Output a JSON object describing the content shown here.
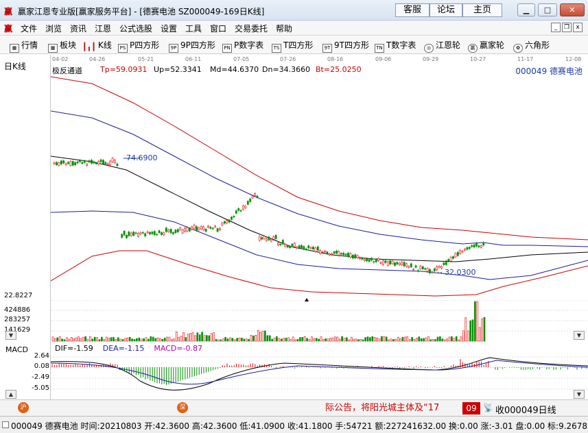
{
  "window": {
    "app_icon": "赢",
    "title": "赢家江恩专业版[赢家服务平台] - [德赛电池  SZ000049-169日K线]",
    "links": [
      "客服",
      "论坛",
      "主页"
    ],
    "buttons": [
      "minimize-icon",
      "maximize-icon",
      "close-icon"
    ]
  },
  "menu": {
    "icon": "赢",
    "items": [
      "文件",
      "浏览",
      "资讯",
      "江恩",
      "公式选股",
      "设置",
      "工具",
      "窗口",
      "交易委托",
      "帮助"
    ]
  },
  "toolbar": {
    "items": [
      {
        "label": "行情",
        "icon": "grid-icon",
        "glyph": "▦"
      },
      {
        "label": "板块",
        "icon": "blocks-icon",
        "glyph": "▦"
      },
      {
        "label": "K线",
        "icon": "candlestick-icon",
        "glyph": "┃╻┃"
      },
      {
        "label": "P四方形",
        "icon": "p-square-icon",
        "glyph": "PS"
      },
      {
        "label": "9P四方形",
        "icon": "9p-square-icon",
        "glyph": "9P"
      },
      {
        "label": "P数字表",
        "icon": "p-number-table-icon",
        "glyph": "PN"
      },
      {
        "label": "T四方形",
        "icon": "t-square-icon",
        "glyph": "TS"
      },
      {
        "label": "9T四方形",
        "icon": "9t-square-icon",
        "glyph": "9T"
      },
      {
        "label": "T数字表",
        "icon": "t-number-table-icon",
        "glyph": "TN"
      },
      {
        "label": "江恩轮",
        "icon": "gann-wheel-icon",
        "glyph": "◎"
      },
      {
        "label": "赢家轮",
        "icon": "winner-wheel-icon",
        "glyph": "赢"
      },
      {
        "label": "六角形",
        "icon": "hexagon-icon",
        "glyph": "✿"
      }
    ]
  },
  "chart": {
    "period": "日K线",
    "dates": [
      "04-02",
      "04-26",
      "05-21",
      "06-11",
      "07-05",
      "07-26",
      "08-16",
      "09-06",
      "09-29",
      "10-27",
      "11-17",
      "12-08"
    ],
    "indicator": {
      "name": "极反通道",
      "tp": "Tp=59.0931",
      "up": "Up=52.3341",
      "md": "Md=44.6370",
      "dn": "Dn=34.3660",
      "bt": "Bt=25.0250"
    },
    "stock_label": "000049  德赛电池",
    "annot_high": "74.6900",
    "annot_low": "32.0300",
    "volume_axis": [
      "22.8227",
      "424886",
      "283257",
      "141629"
    ],
    "macd": {
      "name": "MACD",
      "dif": "DIF=-1.59",
      "dea": "DEA=-1.15",
      "macd": "MACD=-0.87",
      "axis": [
        "2.64",
        "0.08",
        "-2.49",
        "-5.05"
      ]
    },
    "colors": {
      "up": "#e60000",
      "down": "#009000",
      "band_outer": "#cc0000",
      "band_up": "#1a1aa0",
      "band_mid": "#000000",
      "annot": "#1a3aa0",
      "dif": "#000000",
      "dea": "#1a1aa0"
    }
  },
  "bottom": {
    "market_left": "沪",
    "market_mid": "深",
    "ticker_text": "际公告，将阳光城主体及“17",
    "ticker_num": "09",
    "radio_icon": "antenna-icon",
    "collect_text": "收000049日线"
  },
  "status": {
    "text": "000049 德赛电池 时间:20210803 开:42.3600 高:42.3600 低:41.0900 收:41.1800 手:54721 额:227241632.00 换:0.00 涨:-3.01 盘:0.00 标:9.2678"
  }
}
